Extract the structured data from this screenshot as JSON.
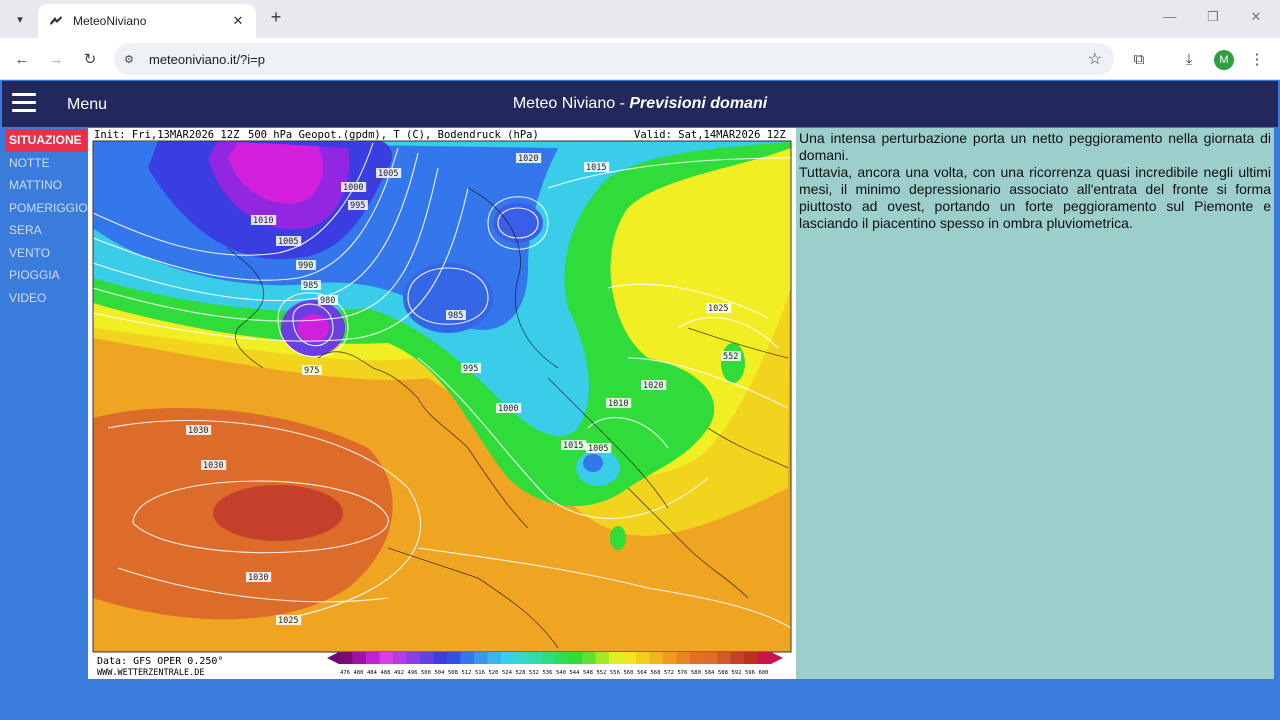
{
  "browser": {
    "tab_title": "MeteoNiviano",
    "url": "meteoniviano.it/?i=p",
    "profile_initial": "M"
  },
  "site": {
    "menu_label": "Menu",
    "title_main": "Meteo Niviano - ",
    "title_sub": "Previsioni domani"
  },
  "sidebar": {
    "items": [
      {
        "label": "SITUAZIONE",
        "active": true
      },
      {
        "label": "NOTTE"
      },
      {
        "label": "MATTINO"
      },
      {
        "label": "POMERIGGIO"
      },
      {
        "label": "SERA"
      },
      {
        "label": "VENTO"
      },
      {
        "label": "PIOGGIA"
      },
      {
        "label": "VIDEO"
      }
    ]
  },
  "map": {
    "header_left": "Init: Fri,13MAR2026 12Z",
    "header_mid": "500 hPa Geopot.(gpdm), T (C), Bodendruck (hPa)",
    "header_right": "Valid: Sat,14MAR2026 12Z",
    "footer_line1": "Data: GFS OPER 0.250°",
    "footer_line2": "WWW.WETTERZENTRALE.DE",
    "scale_labels": [
      "476",
      "480",
      "484",
      "488",
      "492",
      "496",
      "500",
      "504",
      "508",
      "512",
      "516",
      "520",
      "524",
      "528",
      "532",
      "536",
      "540",
      "544",
      "548",
      "552",
      "556",
      "560",
      "564",
      "568",
      "572",
      "576",
      "580",
      "584",
      "588",
      "592",
      "596",
      "600"
    ],
    "isobar_labels": [
      {
        "t": "1020",
        "lvl": "h"
      },
      {
        "t": "1015",
        "lvl": "h"
      },
      {
        "t": "1005",
        "lvl": "l"
      },
      {
        "t": "1000",
        "lvl": "l"
      },
      {
        "t": "995",
        "lvl": "l"
      },
      {
        "t": "1010",
        "lvl": "m"
      },
      {
        "t": "1005",
        "lvl": "l"
      },
      {
        "t": "990",
        "lvl": "l"
      },
      {
        "t": "985",
        "lvl": "l"
      },
      {
        "t": "980",
        "lvl": "l"
      },
      {
        "t": "975",
        "lvl": "l"
      },
      {
        "t": "1030",
        "lvl": "h"
      },
      {
        "t": "1030",
        "lvl": "h"
      },
      {
        "t": "1025",
        "lvl": "h"
      },
      {
        "t": "1030",
        "lvl": "h"
      },
      {
        "t": "1025",
        "lvl": "h"
      },
      {
        "t": "1020",
        "lvl": "h"
      },
      {
        "t": "1010",
        "lvl": "m"
      },
      {
        "t": "1015",
        "lvl": "h"
      },
      {
        "t": "1005",
        "lvl": "l"
      },
      {
        "t": "1000",
        "lvl": "l"
      },
      {
        "t": "995",
        "lvl": "l"
      },
      {
        "t": "985",
        "lvl": "l"
      },
      {
        "t": "552",
        "lvl": "g"
      }
    ],
    "colors": {
      "purple": "#c21fd9",
      "blue": "#2f5fe8",
      "cyan": "#3fd0ee",
      "green": "#2fdc3a",
      "yellow": "#f1ee1e",
      "orange": "#f09a22",
      "red": "#d9532a",
      "darkred": "#b8321f"
    }
  },
  "text": {
    "p1": "Una intensa perturbazione porta un netto peggioramento nella giornata di domani.",
    "p2": "Tuttavia, ancora una volta, con una ricorrenza quasi incredibile negli ultimi mesi, il minimo depressionario associato all'entrata del fronte si forma piuttosto ad ovest, portando un forte peggioramento sul Piemonte e lasciando il piacentino spesso in ombra pluviometrica."
  }
}
